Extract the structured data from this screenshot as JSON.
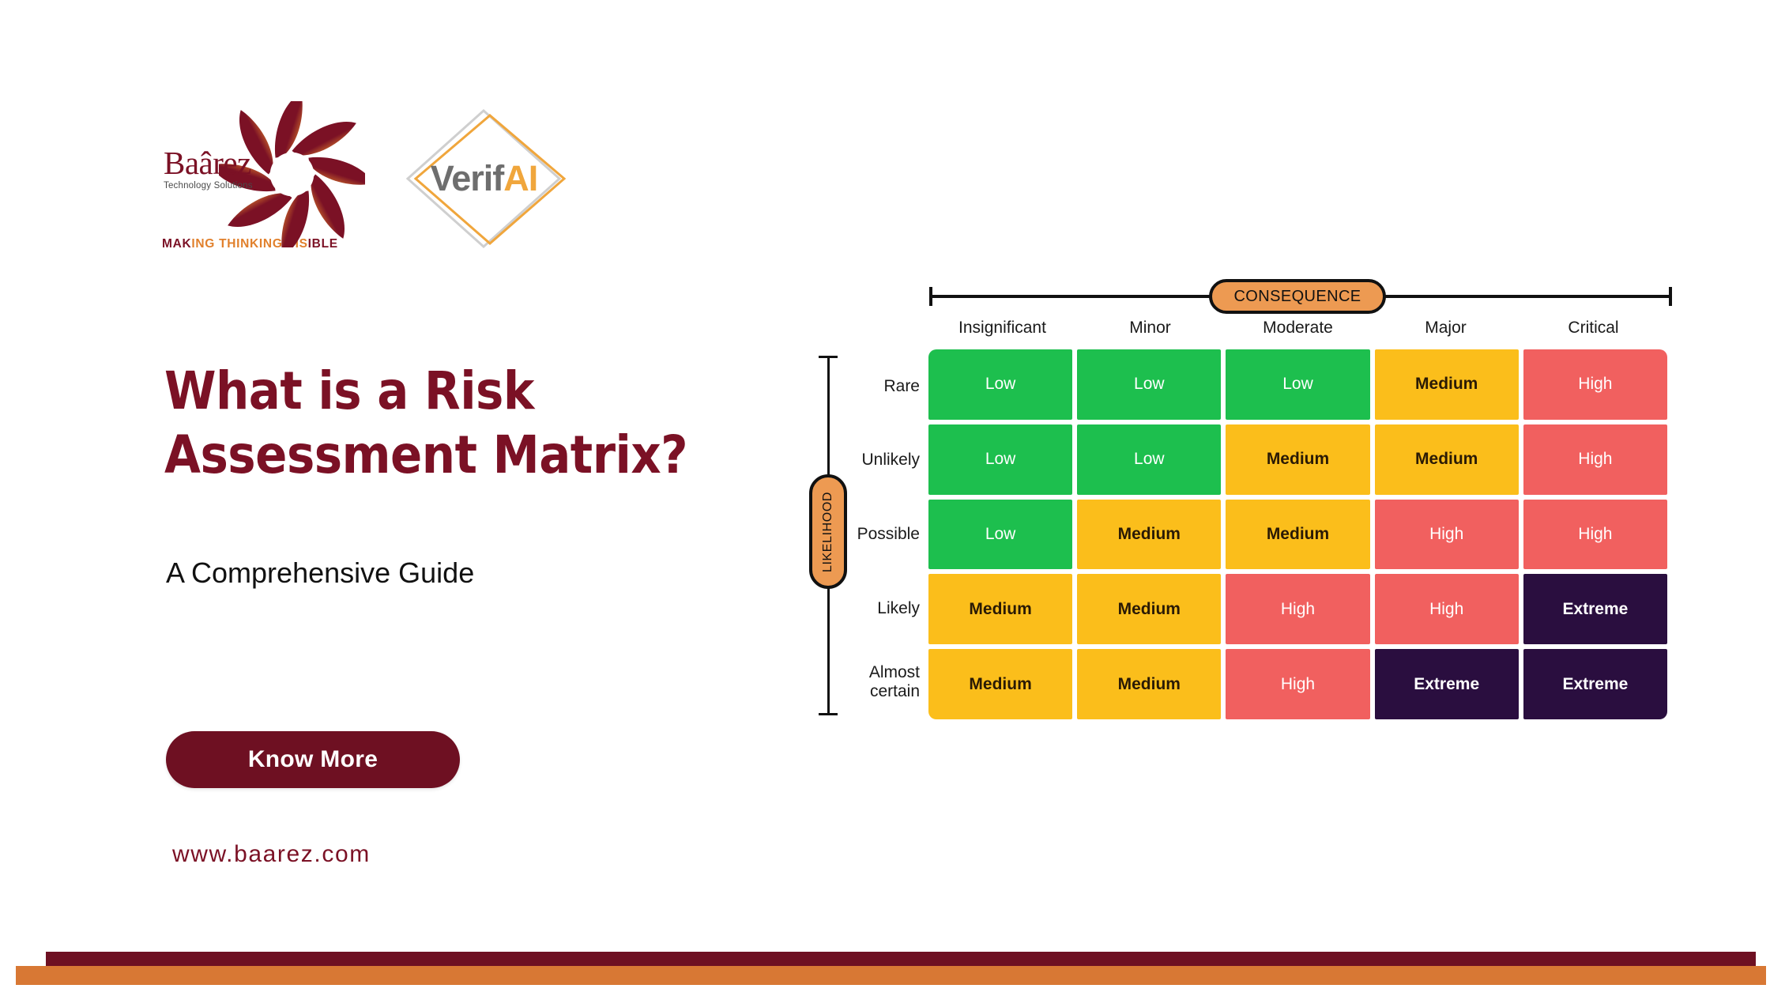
{
  "brand": {
    "baarez_name": "Baârez",
    "baarez_subtitle": "Technology Solutions",
    "tagline_part1": "MAK",
    "tagline_part2": "ING THINKING VIS",
    "tagline_part3": "IBLE",
    "verifai_part1": "Verif",
    "verifai_part2": "AI",
    "colors": {
      "maroon": "#7b1125",
      "orange": "#e1802c",
      "verifai_gray": "#6e6e6e",
      "verifai_orange": "#f0a63c"
    }
  },
  "hero": {
    "headline": "What is a Risk Assessment Matrix?",
    "subhead": "A Comprehensive Guide",
    "cta_label": "Know More",
    "website": "www.baarez.com"
  },
  "chart_data": {
    "type": "heatmap",
    "title": "Risk Assessment Matrix",
    "xlabel": "CONSEQUENCE",
    "ylabel": "LIKELIHOOD",
    "categories": [
      "Insignificant",
      "Minor",
      "Moderate",
      "Major",
      "Critical"
    ],
    "rows": [
      "Rare",
      "Unlikely",
      "Possible",
      "Likely",
      "Almost certain"
    ],
    "legend_position": "none",
    "grid": false,
    "levels": [
      "Low",
      "Medium",
      "High",
      "Extreme"
    ],
    "level_colors": {
      "Low": "#1DBF4E",
      "Medium": "#FBBE1B",
      "High": "#F1605F",
      "Extreme": "#2A0E3F"
    },
    "values": [
      [
        "Low",
        "Low",
        "Low",
        "Medium",
        "High"
      ],
      [
        "Low",
        "Low",
        "Medium",
        "Medium",
        "High"
      ],
      [
        "Low",
        "Medium",
        "Medium",
        "High",
        "High"
      ],
      [
        "Medium",
        "Medium",
        "High",
        "High",
        "Extreme"
      ],
      [
        "Medium",
        "Medium",
        "High",
        "Extreme",
        "Extreme"
      ]
    ]
  }
}
